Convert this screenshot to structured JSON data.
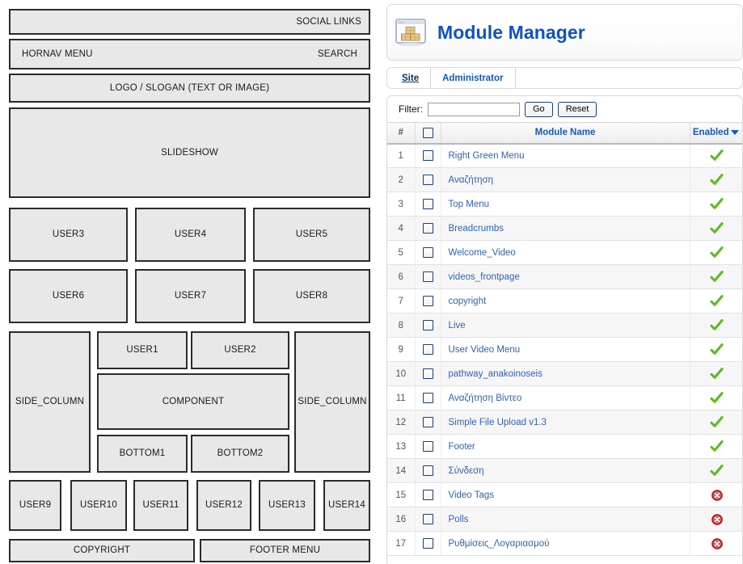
{
  "layout_diagram": {
    "name": "template-layout-diagram",
    "boxes": [
      {
        "id": "social-links",
        "label": "SOCIAL LINKS",
        "align": "right"
      },
      {
        "id": "hornav-search",
        "label_left": "HORNAV MENU",
        "label_right": "SEARCH",
        "align": "split"
      },
      {
        "id": "logo-slogan",
        "label": "LOGO / SLOGAN (TEXT OR IMAGE)",
        "align": "center"
      },
      {
        "id": "slideshow",
        "label": "SLIDESHOW",
        "align": "center"
      },
      {
        "id": "user3",
        "label": "USER3",
        "align": "center"
      },
      {
        "id": "user4",
        "label": "USER4",
        "align": "center"
      },
      {
        "id": "user5",
        "label": "USER5",
        "align": "center"
      },
      {
        "id": "user6",
        "label": "USER6",
        "align": "center"
      },
      {
        "id": "user7",
        "label": "USER7",
        "align": "center"
      },
      {
        "id": "user8",
        "label": "USER8",
        "align": "center"
      },
      {
        "id": "side-column-left",
        "label": "SIDE_COLUMN",
        "align": "center"
      },
      {
        "id": "user1",
        "label": "USER1",
        "align": "center"
      },
      {
        "id": "user2",
        "label": "USER2",
        "align": "center"
      },
      {
        "id": "component",
        "label": "COMPONENT",
        "align": "center"
      },
      {
        "id": "bottom1",
        "label": "BOTTOM1",
        "align": "center"
      },
      {
        "id": "bottom2",
        "label": "BOTTOM2",
        "align": "center"
      },
      {
        "id": "side-column-right",
        "label": "SIDE_COLUMN",
        "align": "center"
      },
      {
        "id": "user9",
        "label": "USER9",
        "align": "center"
      },
      {
        "id": "user10",
        "label": "USER10",
        "align": "center"
      },
      {
        "id": "user11",
        "label": "USER11",
        "align": "center"
      },
      {
        "id": "user12",
        "label": "USER12",
        "align": "center"
      },
      {
        "id": "user13",
        "label": "USER13",
        "align": "center"
      },
      {
        "id": "user14",
        "label": "USER14",
        "align": "center"
      },
      {
        "id": "copyright",
        "label": "COPYRIGHT",
        "align": "center"
      },
      {
        "id": "footer-menu",
        "label": "FOOTER MENU",
        "align": "center"
      }
    ]
  },
  "admin": {
    "header": {
      "title": "Module Manager",
      "icon": "module-manager-icon",
      "title_color": "#0d52c4"
    },
    "tabs": [
      {
        "label": "Site",
        "active": true
      },
      {
        "label": "Administrator",
        "active": false
      }
    ],
    "filter": {
      "label": "Filter:",
      "value": "",
      "placeholder": "",
      "go_label": "Go",
      "reset_label": "Reset"
    },
    "table": {
      "columns": {
        "num": "#",
        "check": "",
        "name": "Module Name",
        "enabled": "Enabled"
      },
      "sort": {
        "column": "Enabled",
        "direction": "desc",
        "indicator": "chevron-down-icon"
      },
      "select_all_checked": false,
      "rows": [
        {
          "num": 1,
          "name": "Right Green Menu",
          "enabled": true,
          "checked": false
        },
        {
          "num": 2,
          "name": "Αναζήτηση",
          "enabled": true,
          "checked": false
        },
        {
          "num": 3,
          "name": "Top Menu",
          "enabled": true,
          "checked": false
        },
        {
          "num": 4,
          "name": "Breadcrumbs",
          "enabled": true,
          "checked": false
        },
        {
          "num": 5,
          "name": "Welcome_Video",
          "enabled": true,
          "checked": false
        },
        {
          "num": 6,
          "name": "videos_frontpage",
          "enabled": true,
          "checked": false
        },
        {
          "num": 7,
          "name": "copyright",
          "enabled": true,
          "checked": false
        },
        {
          "num": 8,
          "name": "Live",
          "enabled": true,
          "checked": false
        },
        {
          "num": 9,
          "name": "User Video Menu",
          "enabled": true,
          "checked": false
        },
        {
          "num": 10,
          "name": "pathway_anakoinoseis",
          "enabled": true,
          "checked": false
        },
        {
          "num": 11,
          "name": "Αναζήτηση Βίντεο",
          "enabled": true,
          "checked": false
        },
        {
          "num": 12,
          "name": "Simple File Upload v1.3",
          "enabled": true,
          "checked": false
        },
        {
          "num": 13,
          "name": "Footer",
          "enabled": true,
          "checked": false
        },
        {
          "num": 14,
          "name": "Σύνδεση",
          "enabled": true,
          "checked": false
        },
        {
          "num": 15,
          "name": "Video Tags",
          "enabled": false,
          "checked": false
        },
        {
          "num": 16,
          "name": "Polls",
          "enabled": false,
          "checked": false
        },
        {
          "num": 17,
          "name": "Ρυθμίσεις_Λογαριασμού",
          "enabled": false,
          "checked": false
        }
      ],
      "enabled_icon_yes": "green-check-icon",
      "enabled_icon_no": "red-x-circle-icon",
      "enabled_color_yes": "#4faa1e",
      "enabled_color_no": "#d81a20",
      "link_color": "#2e63b0"
    }
  }
}
